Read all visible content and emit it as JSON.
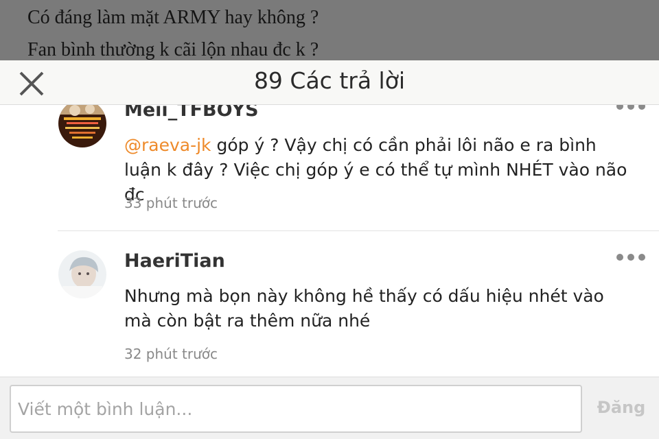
{
  "story": {
    "line1": "Có đáng làm mặt ARMY hay không ?",
    "line2": "Fan bình thường k cãi lộn nhau đc k ?"
  },
  "header": {
    "title": "89 Các trả lời",
    "close_icon": "close-icon"
  },
  "comments": [
    {
      "username": "Meii_TFBOYS",
      "mention": "@raeva-jk",
      "text": " góp ý ? Vậy chị có cần phải lôi não e ra bình luận k đây ? Việc chị góp ý e có thể tự mình NHÉT vào não đc",
      "time": "33 phút trước"
    },
    {
      "username": "HaeriTian",
      "text": "Nhưng mà bọn này không hề thấy có dấu hiệu nhét vào mà còn bật ra thêm nữa nhé",
      "time": "32 phút trước"
    }
  ],
  "composer": {
    "placeholder": "Viết một bình luận...",
    "post_label": "Đăng"
  },
  "colors": {
    "mention": "#ee8a2a",
    "overlay": "#7a7a7a",
    "header_bg": "#f8f8f6"
  }
}
